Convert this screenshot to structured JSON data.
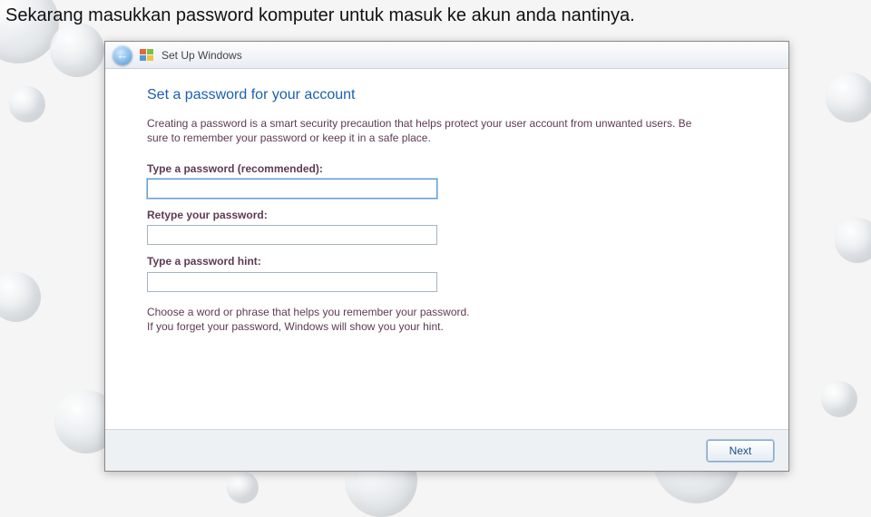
{
  "caption": "Sekarang masukkan password komputer untuk masuk ke akun anda nantinya.",
  "window": {
    "title": "Set Up Windows",
    "heading": "Set a password for your account",
    "description": "Creating a password is a smart security precaution that helps protect your user account from unwanted users. Be sure to remember your password or keep it in a safe place.",
    "fields": {
      "password": {
        "label": "Type a password (recommended):",
        "value": ""
      },
      "retype": {
        "label": "Retype your password:",
        "value": ""
      },
      "hint": {
        "label": "Type a password hint:",
        "value": ""
      }
    },
    "hint_help_line1": "Choose a word or phrase that helps you remember your password.",
    "hint_help_line2": "If you forget your password, Windows will show you your hint.",
    "next_button": "Next"
  }
}
